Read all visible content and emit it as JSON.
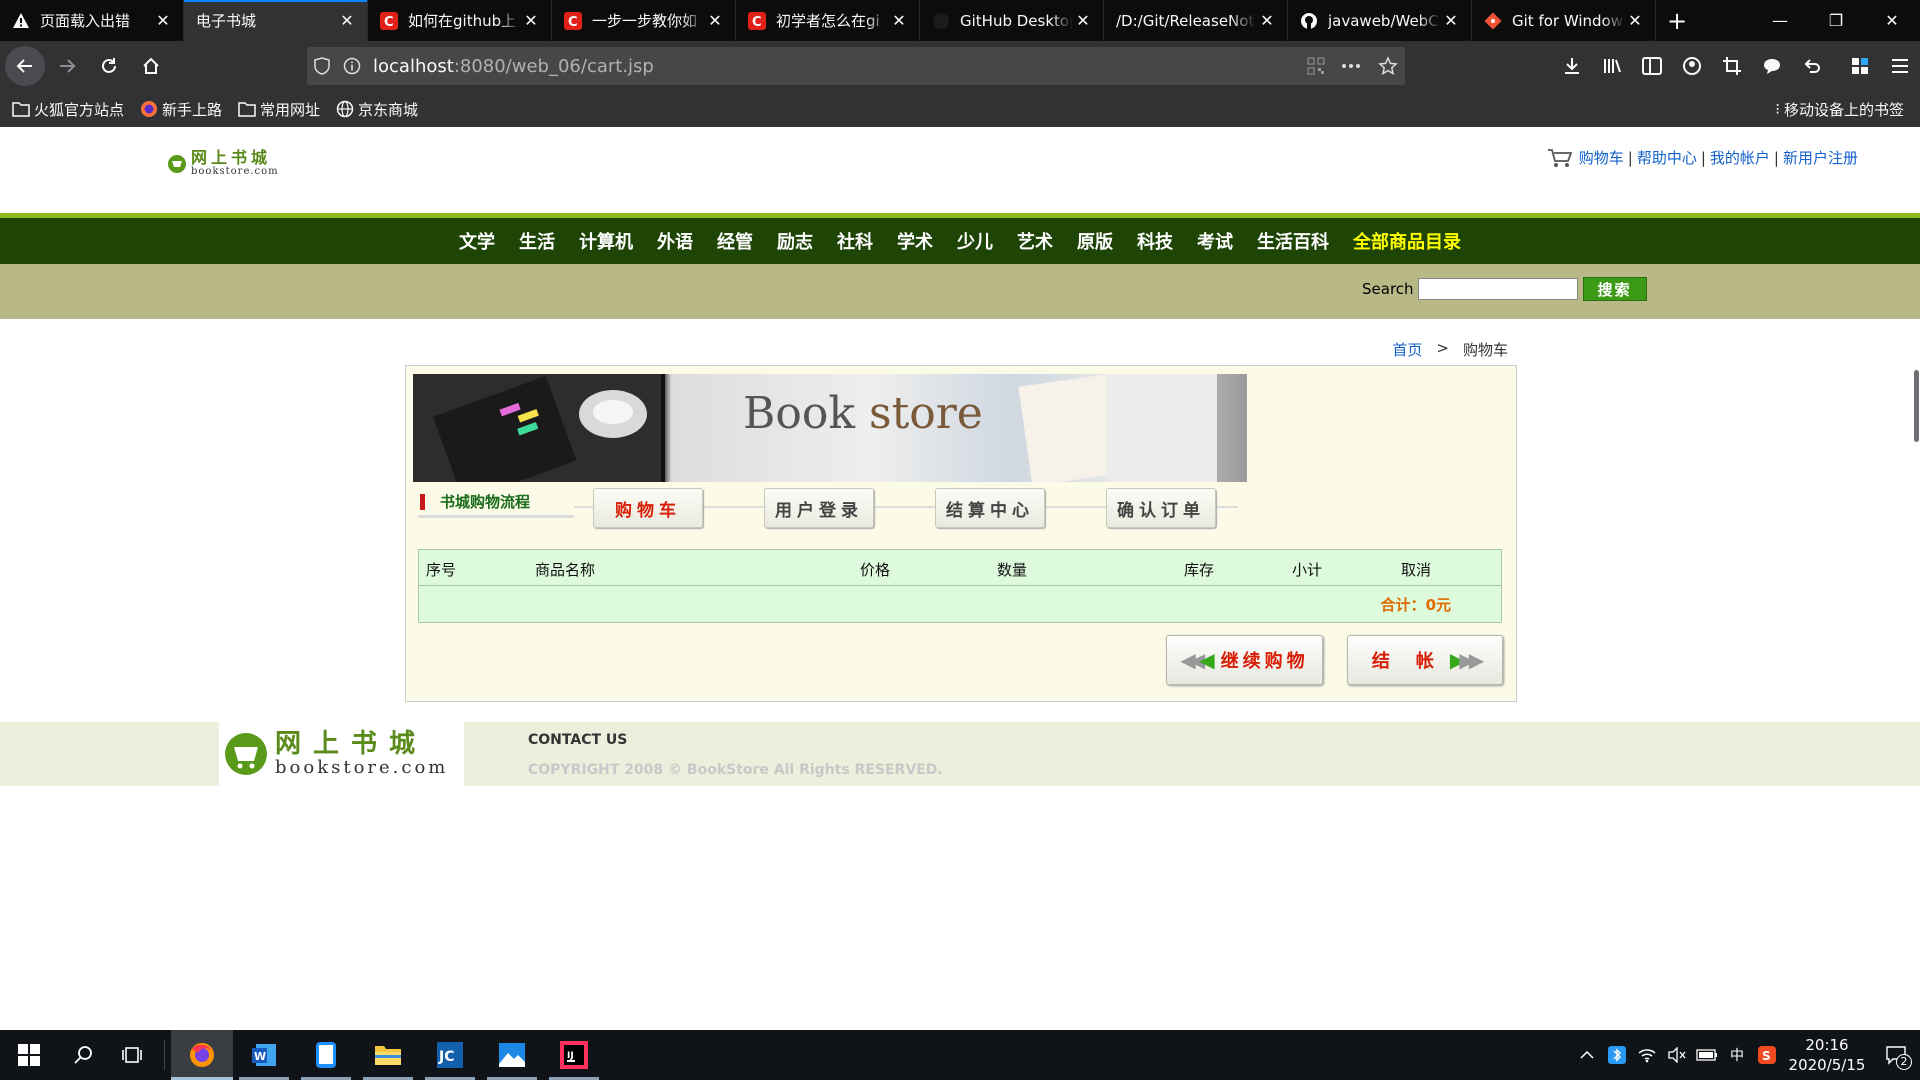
{
  "browser": {
    "tabs": [
      {
        "title": "页面载入出错",
        "icon": "warning-icon",
        "active": false
      },
      {
        "title": "电子书城",
        "icon": "",
        "active": true
      },
      {
        "title": "如何在github上",
        "icon": "csdn-icon",
        "active": false
      },
      {
        "title": "一步一步教你如",
        "icon": "csdn-icon",
        "active": false
      },
      {
        "title": "初学者怎么在gi",
        "icon": "csdn-icon",
        "active": false
      },
      {
        "title": "GitHub Desktop",
        "icon": "github-icon",
        "active": false
      },
      {
        "title": "/D:/Git/ReleaseNot",
        "icon": "",
        "active": false
      },
      {
        "title": "javaweb/WebC",
        "icon": "github-icon",
        "active": false
      },
      {
        "title": "Git for Windows",
        "icon": "git-icon",
        "active": false
      }
    ],
    "url_host": "localhost",
    "url_rest": ":8080/web_06/cart.jsp",
    "bookmarks": [
      {
        "label": "火狐官方站点",
        "icon": "folder-icon"
      },
      {
        "label": "新手上路",
        "icon": "firefox-icon"
      },
      {
        "label": "常用网址",
        "icon": "folder-icon"
      },
      {
        "label": "京东商城",
        "icon": "globe-icon"
      }
    ],
    "mobile_bookmarks": "移动设备上的书签"
  },
  "site": {
    "logo_cn": "网上书城",
    "logo_en": "bookstore.com",
    "top_links": [
      "购物车",
      "帮助中心",
      "我的帐户",
      "新用户注册"
    ],
    "categories": [
      "文学",
      "生活",
      "计算机",
      "外语",
      "经管",
      "励志",
      "社科",
      "学术",
      "少儿",
      "艺术",
      "原版",
      "科技",
      "考试",
      "生活百科"
    ],
    "all_categories": "全部商品目录",
    "search_label": "Search",
    "search_button": "搜索",
    "search_value": ""
  },
  "breadcrumb": {
    "home": "首页",
    "sep": ">",
    "current": "购物车"
  },
  "banner": {
    "title_a": "Book",
    "title_b": "store"
  },
  "flow": {
    "title": "书城购物流程",
    "steps": [
      "购物车",
      "用户登录",
      "结算中心",
      "确认订单"
    ]
  },
  "cart": {
    "columns": [
      "序号",
      "商品名称",
      "价格",
      "数量",
      "库存",
      "小计",
      "取消"
    ],
    "total_label": "合计：",
    "total_value": "0元",
    "continue_button": "继续购物",
    "checkout_button": "结　帐"
  },
  "footer": {
    "logo_cn": "网上书城",
    "logo_en": "bookstore.com",
    "contact": "CONTACT US",
    "copyright": "COPYRIGHT 2008 © BookStore All Rights RESERVED."
  },
  "taskbar": {
    "apps": [
      "firefox-icon",
      "word-icon",
      "tablet-icon",
      "file-explorer-icon",
      "editor-icon",
      "photos-icon",
      "intellij-icon"
    ],
    "time": "20:16",
    "date": "2020/5/15",
    "ime": "中",
    "notification_count": "2"
  }
}
